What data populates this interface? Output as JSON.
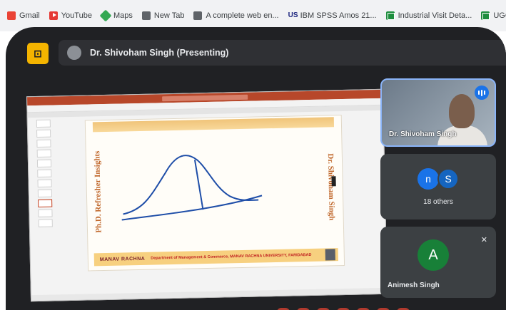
{
  "bookmarks": [
    {
      "label": "Gmail",
      "icon": "gmail-icon"
    },
    {
      "label": "YouTube",
      "icon": "youtube-icon"
    },
    {
      "label": "Maps",
      "icon": "maps-icon"
    },
    {
      "label": "New Tab",
      "icon": "globe-icon"
    },
    {
      "label": "A complete web en...",
      "icon": "globe-icon"
    },
    {
      "label": "IBM SPSS Amos 21...",
      "icon": "us-icon"
    },
    {
      "label": "Industrial Visit Deta...",
      "icon": "sheets-icon"
    },
    {
      "label": "UGC virtual",
      "icon": "sheets-icon"
    }
  ],
  "meet": {
    "logo_glyph": "⊡",
    "presenting_title": "Dr. Shivoham Singh (Presenting)",
    "tiles": {
      "presenter_name": "Dr. Shivoham Singh",
      "others_bubbles": [
        "n",
        "S"
      ],
      "others_label": "18 others",
      "participant_initial": "A",
      "participant_name": "Animesh Singh"
    }
  },
  "slide": {
    "left_text": "Ph.D. Refresher Insights",
    "right_text": "Dr. Shivoham Singh",
    "logo_text": "MANAV RACHNA",
    "footer_text": "Department of Management & Commerce, MANAV RACHNA UNIVERSITY, FARIDABAD"
  },
  "colors": {
    "meet_bg": "#202124",
    "accent": "#1a73e8",
    "ppt_red": "#b7472a"
  }
}
